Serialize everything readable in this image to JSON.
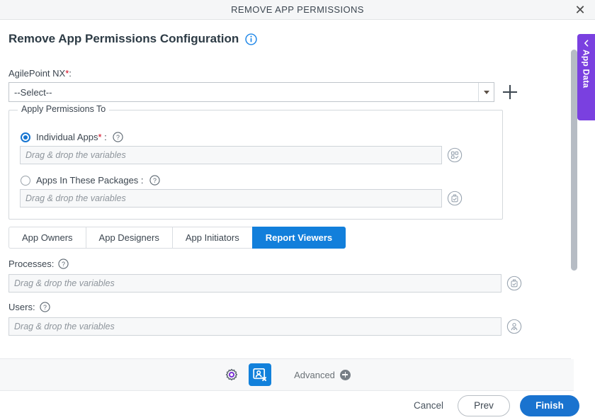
{
  "window": {
    "title": "REMOVE APP PERMISSIONS",
    "close_icon": "close-icon"
  },
  "page": {
    "heading": "Remove App Permissions Configuration",
    "heading_info_icon": "info-circle-icon"
  },
  "agilepoint": {
    "label": "AgilePoint NX",
    "required_mark": "*",
    "label_colon": ":",
    "selected_value": "--Select--",
    "dropdown_icon": "chevron-down-icon",
    "add_icon": "plus-icon"
  },
  "permissions_group": {
    "legend": "Apply Permissions To",
    "options": [
      {
        "label": "Individual Apps",
        "required_mark": "*",
        "colon": ":",
        "selected": true,
        "help_icon": "question-circle-icon",
        "input_placeholder": "Drag & drop the variables",
        "input_value": "",
        "picker_icon": "apps-picker-icon"
      },
      {
        "label": "Apps In These Packages",
        "required_mark": "",
        "colon": ":",
        "selected": false,
        "help_icon": "question-circle-icon",
        "input_placeholder": "Drag & drop the variables",
        "input_value": "",
        "picker_icon": "package-picker-icon"
      }
    ]
  },
  "tabs": [
    {
      "label": "App Owners",
      "active": false
    },
    {
      "label": "App Designers",
      "active": false
    },
    {
      "label": "App Initiators",
      "active": false
    },
    {
      "label": "Report Viewers",
      "active": true
    }
  ],
  "fields": [
    {
      "label": "Processes:",
      "help_icon": "question-circle-icon",
      "placeholder": "Drag & drop the variables",
      "value": "",
      "picker_icon": "process-picker-icon"
    },
    {
      "label": "Users:",
      "help_icon": "question-circle-icon",
      "placeholder": "Drag & drop the variables",
      "value": "",
      "picker_icon": "user-picker-icon"
    }
  ],
  "toolbar": {
    "settings_icon": "gear-icon",
    "remove_permission_icon": "remove-app-permission-icon",
    "advanced_label": "Advanced",
    "advanced_add_icon": "plus-circle-icon"
  },
  "footer": {
    "cancel_label": "Cancel",
    "prev_label": "Prev",
    "finish_label": "Finish"
  },
  "side_panel": {
    "label": "App Data",
    "collapse_icon": "chevron-left-icon"
  },
  "colors": {
    "accent_blue": "#127fdb",
    "primary_button": "#1a73cf",
    "purple": "#7a40e0",
    "required_red": "#d0021b",
    "text": "#3c4650"
  }
}
